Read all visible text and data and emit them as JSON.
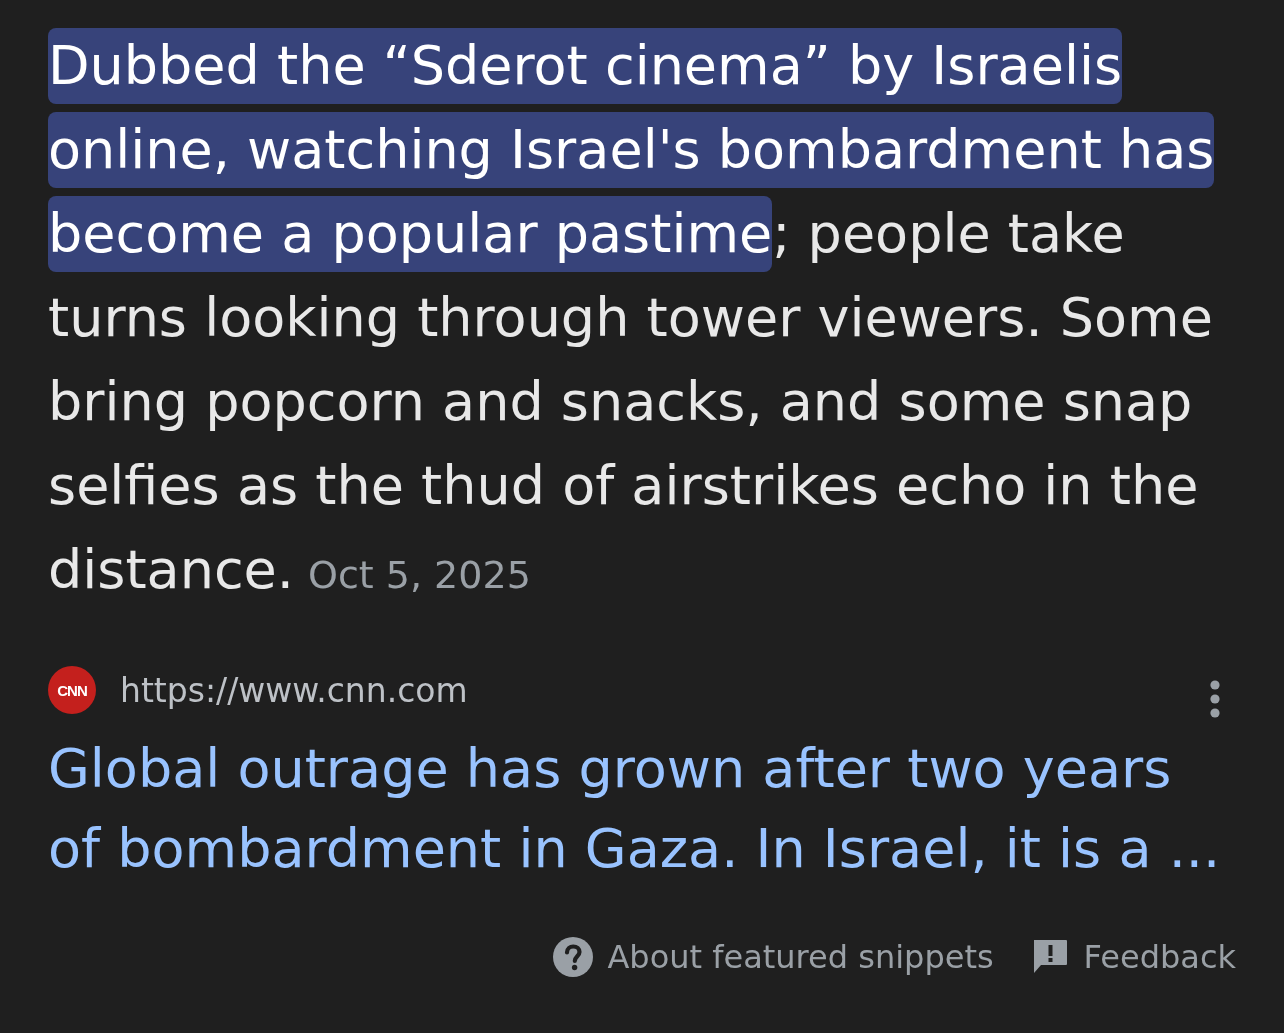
{
  "snippet": {
    "highlighted_text": "Dubbed the “Sderot cinema” by Israelis online, watching Israel's bombardment has become a popular pastime",
    "text": "; people take turns looking through tower viewers. Some bring popcorn and snacks, and some snap selfies as the thud of airstrikes echo in the distance.",
    "date": "Oct 5, 2025"
  },
  "source": {
    "logo_text": "CNN",
    "url": "https://www.cnn.com",
    "title": "Global outrage has grown after two years of bombardment in Gaza. In Israel, it is a ..."
  },
  "footer": [
    {
      "kind": "help",
      "label": "About featured snippets"
    },
    {
      "kind": "feedback",
      "label": "Feedback"
    }
  ]
}
